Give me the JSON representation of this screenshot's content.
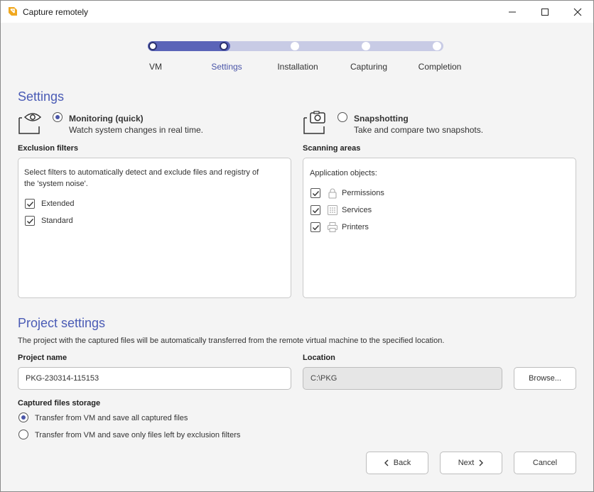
{
  "window": {
    "title": "Capture remotely",
    "accent": "#4a5bb5",
    "app_icon_color": "#f0a820"
  },
  "stepper": {
    "steps": [
      "VM",
      "Settings",
      "Installation",
      "Capturing",
      "Completion"
    ],
    "active_index": 1
  },
  "settings": {
    "title": "Settings",
    "monitoring": {
      "title": "Monitoring (quick)",
      "description": "Watch system changes in real time.",
      "selected": true,
      "icon": "eye-icon"
    },
    "snapshotting": {
      "title": "Snapshotting",
      "description": "Take and compare two snapshots.",
      "selected": false,
      "icon": "camera-icon"
    },
    "exclusion_filters": {
      "label": "Exclusion filters",
      "description_line1": "Select filters to automatically detect and exclude files and registry of",
      "description_line2": "the 'system noise'.",
      "items": [
        {
          "label": "Extended",
          "checked": true
        },
        {
          "label": "Standard",
          "checked": true
        }
      ]
    },
    "scanning_areas": {
      "label": "Scanning areas",
      "heading": "Application objects:",
      "items": [
        {
          "label": "Permissions",
          "checked": true,
          "icon": "lock-icon"
        },
        {
          "label": "Services",
          "checked": true,
          "icon": "services-grid-icon"
        },
        {
          "label": "Printers",
          "checked": true,
          "icon": "printer-icon"
        }
      ]
    }
  },
  "project": {
    "title": "Project settings",
    "description": "The project with the captured files will be automatically transferred from the remote virtual machine to the specified location.",
    "name_label": "Project name",
    "name_value": "PKG-230314-115153",
    "location_label": "Location",
    "location_value": "C:\\PKG",
    "browse_label": "Browse...",
    "storage_label": "Captured files storage",
    "storage_options": [
      {
        "label": "Transfer from VM and save all captured files",
        "selected": true
      },
      {
        "label": "Transfer from VM and save only files left by exclusion filters",
        "selected": false
      }
    ]
  },
  "footer": {
    "back_label": "Back",
    "next_label": "Next",
    "cancel_label": "Cancel"
  }
}
